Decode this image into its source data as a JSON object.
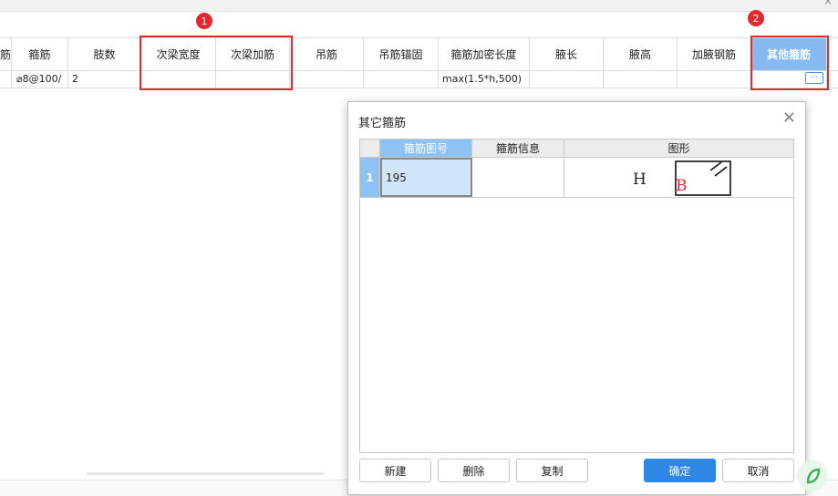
{
  "window": {
    "close_glyph": "×"
  },
  "table": {
    "headers": [
      "筋",
      "箍筋",
      "肢数",
      "次梁宽度",
      "次梁加筋",
      "吊筋",
      "吊筋锚固",
      "箍筋加密长度",
      "腋长",
      "腋高",
      "加腋钢筋",
      "其他箍筋"
    ],
    "row": [
      "",
      "⌀8@100/",
      "2",
      "",
      "",
      "",
      "",
      "max(1.5*h,500)",
      "",
      "",
      "",
      ""
    ],
    "ellipsis_glyph": "···"
  },
  "annotations": {
    "badge1": "1",
    "badge2": "2",
    "color": "#e8262d"
  },
  "dialog": {
    "title": "其它箍筋",
    "close_glyph": "×",
    "grid_headers": [
      "",
      "箍筋图号",
      "箍筋信息",
      "图形"
    ],
    "rows": [
      {
        "num": "1",
        "shape_id": "195",
        "info": "",
        "shape_H": "H",
        "shape_B": "B"
      }
    ],
    "buttons": {
      "new": "新建",
      "delete": "删除",
      "copy": "复制",
      "ok": "确定",
      "cancel": "取消"
    }
  },
  "colors": {
    "accent": "#2f86e6",
    "header_active": "#85b9f0",
    "highlight": "#e8262d"
  }
}
